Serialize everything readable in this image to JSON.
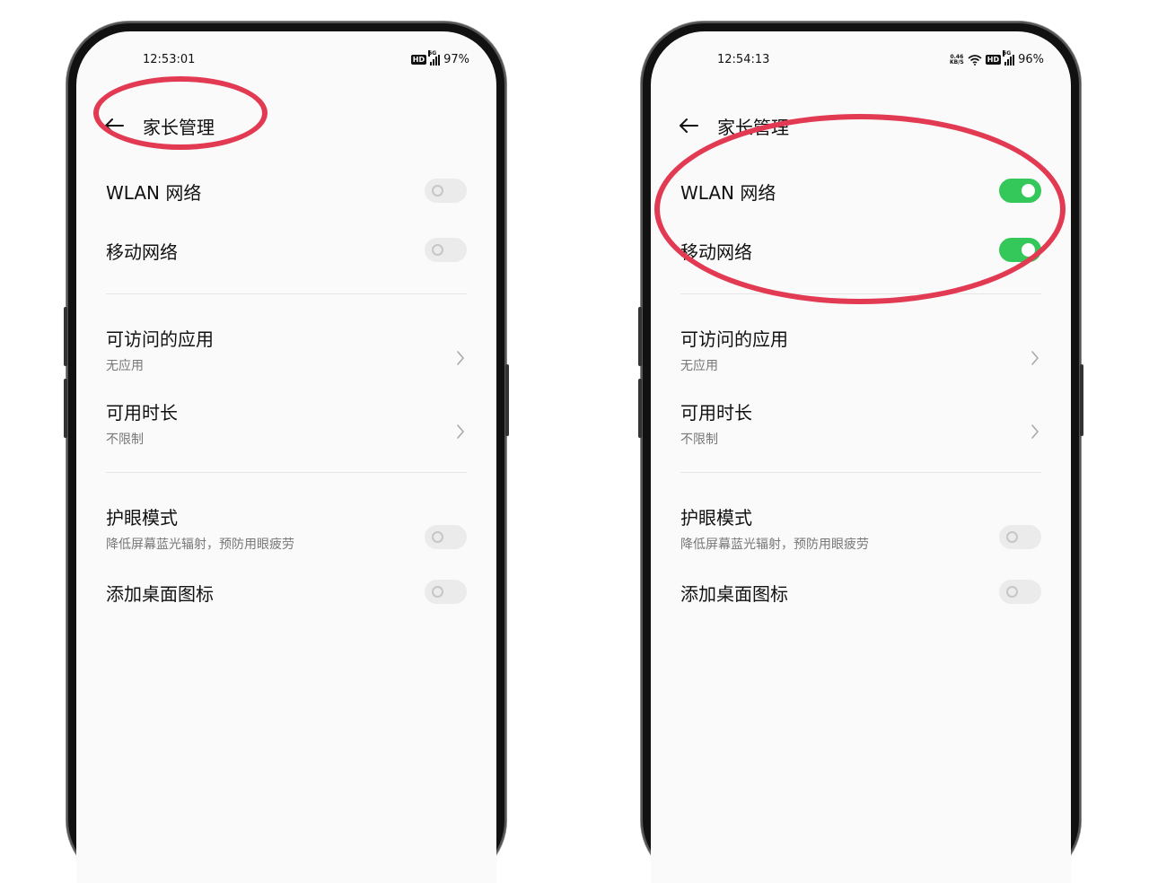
{
  "colors": {
    "toggle_on": "#34c759",
    "toggle_off": "#ebebeb",
    "annotation": "#e23a52",
    "background": "#fafafa"
  },
  "screens": [
    {
      "status": {
        "time": "12:53:01",
        "battery": "97%",
        "hd": "HD",
        "network": "5G"
      },
      "header": {
        "title": "家长管理",
        "back_icon": "arrow-left-icon"
      },
      "settings": {
        "wlan": {
          "label": "WLAN 网络",
          "enabled": false
        },
        "mobile": {
          "label": "移动网络",
          "enabled": false
        },
        "apps": {
          "label": "可访问的应用",
          "sub": "无应用"
        },
        "time_limit": {
          "label": "可用时长",
          "sub": "不限制"
        },
        "eye": {
          "label": "护眼模式",
          "sub": "降低屏幕蓝光辐射，预防用眼疲劳",
          "enabled": false
        },
        "desktop_icon": {
          "label": "添加桌面图标",
          "enabled": false
        }
      }
    },
    {
      "status": {
        "time": "12:54:13",
        "battery": "96%",
        "hd": "HD",
        "network": "5G",
        "net_speed_value": "0.46",
        "net_speed_unit": "KB/S"
      },
      "header": {
        "title": "家长管理",
        "back_icon": "arrow-left-icon"
      },
      "settings": {
        "wlan": {
          "label": "WLAN 网络",
          "enabled": true
        },
        "mobile": {
          "label": "移动网络",
          "enabled": true
        },
        "apps": {
          "label": "可访问的应用",
          "sub": "无应用"
        },
        "time_limit": {
          "label": "可用时长",
          "sub": "不限制"
        },
        "eye": {
          "label": "护眼模式",
          "sub": "降低屏幕蓝光辐射，预防用眼疲劳",
          "enabled": false
        },
        "desktop_icon": {
          "label": "添加桌面图标",
          "enabled": false
        }
      }
    }
  ]
}
